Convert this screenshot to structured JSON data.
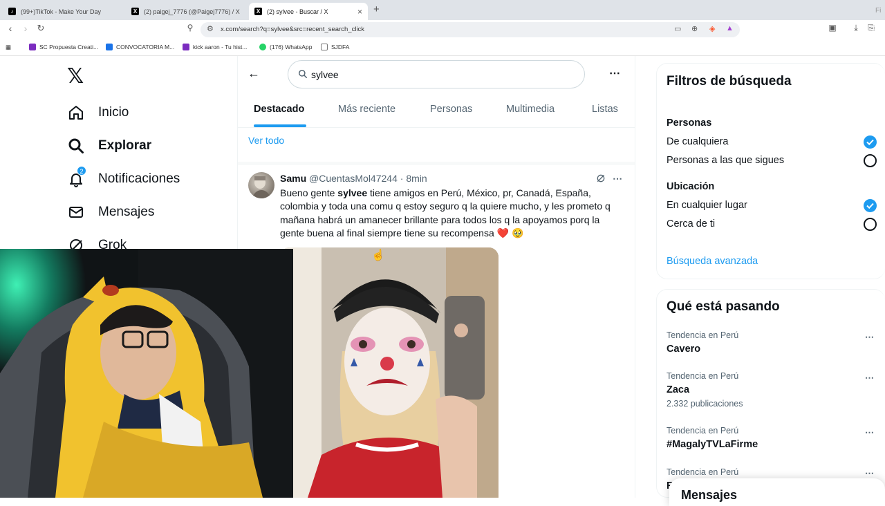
{
  "browser": {
    "tabs": [
      {
        "label": "(99+)TikTok - Make Your Day",
        "favicon": "tiktok-icon"
      },
      {
        "label": "(2) paigej_7776 (@Paigej7776) / X",
        "favicon": "x-icon"
      },
      {
        "label": "(2) sylvee - Buscar / X",
        "favicon": "x-icon",
        "active": true
      }
    ],
    "url": "x.com/search?q=sylvee&src=recent_search_click",
    "tab_edge_text": "Fi",
    "bookmarks": [
      {
        "label": "SC Propuesta Creati...",
        "icon_color": "#7b2cbf"
      },
      {
        "label": "CONVOCATORIA M...",
        "icon_color": "#1a73e8"
      },
      {
        "label": "kick aaron - Tu hist...",
        "icon_color": "#7b2cbf"
      },
      {
        "label": "(176) WhatsApp",
        "icon_color": "#25d366"
      },
      {
        "label": "SJDFA",
        "icon_color": "#777777"
      }
    ]
  },
  "nav": {
    "logo": "𝕏",
    "items": [
      {
        "label": "Inicio",
        "icon": "home-icon"
      },
      {
        "label": "Explorar",
        "icon": "search-icon",
        "bold": true
      },
      {
        "label": "Notificaciones",
        "icon": "bell-icon",
        "badge": "2"
      },
      {
        "label": "Mensajes",
        "icon": "mail-icon"
      },
      {
        "label": "Grok",
        "icon": "grok-icon"
      }
    ]
  },
  "search": {
    "query": "sylvee",
    "tabs": [
      "Destacado",
      "Más reciente",
      "Personas",
      "Multimedia",
      "Listas"
    ],
    "active_tab": "Destacado",
    "see_all": "Ver todo"
  },
  "tweet": {
    "name": "Samu",
    "handle": "@CuentasMol47244",
    "dot": "·",
    "time": "8min",
    "text_before": "Bueno gente ",
    "highlight": "sylvee",
    "text_after": " tiene amigos en Perú, México, pr, Canadá, España, colombia y toda una comu q estoy seguro q la quiere mucho, y les prometo q mañana habrá un amanecer brillante para todos los q la apoyamos porq la gente buena al final siempre tiene su recompensa ",
    "emoji_heart": "❤️",
    "emoji_face": "🥹"
  },
  "filters": {
    "title": "Filtros de búsqueda",
    "people_heading": "Personas",
    "people_options": [
      "De cualquiera",
      "Personas a las que sigues"
    ],
    "people_selected": 0,
    "location_heading": "Ubicación",
    "location_options": [
      "En cualquier lugar",
      "Cerca de ti"
    ],
    "location_selected": 0,
    "advanced": "Búsqueda avanzada"
  },
  "trends": {
    "title": "Qué está pasando",
    "items": [
      {
        "category": "Tendencia en Perú",
        "name": "Cavero",
        "count": ""
      },
      {
        "category": "Tendencia en Perú",
        "name": "Zaca",
        "count": "2.332 publicaciones"
      },
      {
        "category": "Tendencia en Perú",
        "name": "#MagalyTVLaFirme",
        "count": ""
      },
      {
        "category": "Tendencia en Perú",
        "name": "F",
        "count": ""
      }
    ]
  },
  "messages_drawer": "Mensajes",
  "colors": {
    "accent": "#1d9bf0",
    "text": "#0f1419",
    "muted": "#536471",
    "heart": "#e0245e"
  }
}
